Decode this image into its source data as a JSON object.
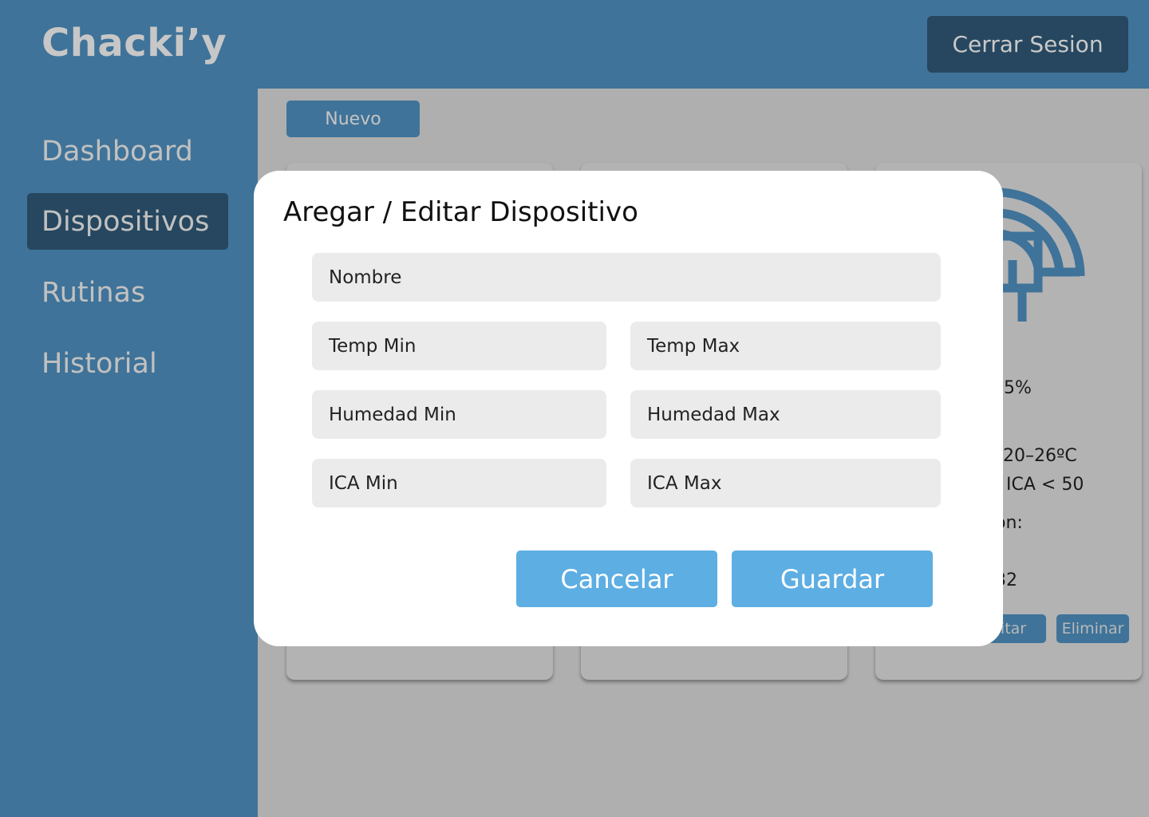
{
  "app": {
    "brand": "Chacki’y",
    "logout_label": "Cerrar Sesion"
  },
  "sidebar": {
    "items": [
      {
        "label": "Dashboard",
        "active": false
      },
      {
        "label": "Dispositivos",
        "active": true
      },
      {
        "label": "Rutinas",
        "active": false
      },
      {
        "label": "Historial",
        "active": false
      }
    ]
  },
  "content": {
    "new_button_label": "Nuevo",
    "card_partial": {
      "humidity_fragment": "5%",
      "temp_range_fragment": "20–26ºC",
      "ica_fragment": "ICA < 50",
      "location_fragment": "ón:",
      "id_fragment": "32",
      "edit_label_fragment": "ditar",
      "delete_label": "Eliminar",
      "icon": "device-chip-icon"
    }
  },
  "modal": {
    "title": "Aregar / Editar Dispositivo",
    "fields": {
      "nombre": "Nombre",
      "temp_min": "Temp Min",
      "temp_max": "Temp Max",
      "humedad_min": "Humedad Min",
      "humedad_max": "Humedad Max",
      "ica_min": "ICA Min",
      "ica_max": "ICA Max"
    },
    "cancel_label": "Cancelar",
    "save_label": "Guardar"
  },
  "colors": {
    "primary": "#3f7399",
    "primary_dark": "#26475f",
    "accent": "#5daee3",
    "overlay": "#afafaf",
    "field_bg": "#ebebeb"
  }
}
